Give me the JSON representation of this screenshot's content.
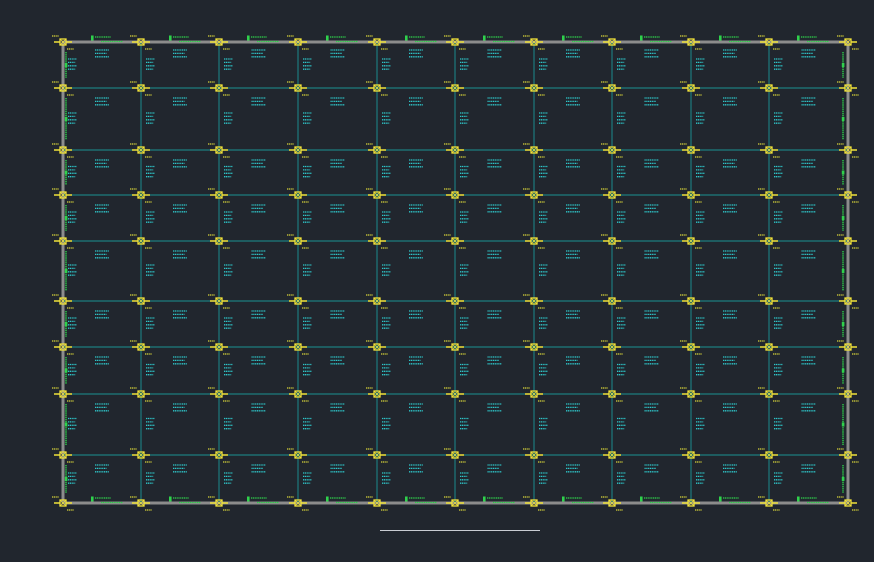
{
  "drawing": {
    "type": "structural floor plan — column grid with beams",
    "grid_columns": 11,
    "grid_rows": 9,
    "colors": {
      "background": "#21262e",
      "frame_beam": "#8c8c8c",
      "grid_beam": "#19b6b6",
      "column": "#f0e23a",
      "annotation_green": "#2fd14c",
      "annotation_cyan": "#2ec5c9",
      "annotation_yellow": "#d8d43a",
      "notes_text": "#c9ccd2"
    }
  },
  "notes": {
    "title": "",
    "lines": []
  }
}
